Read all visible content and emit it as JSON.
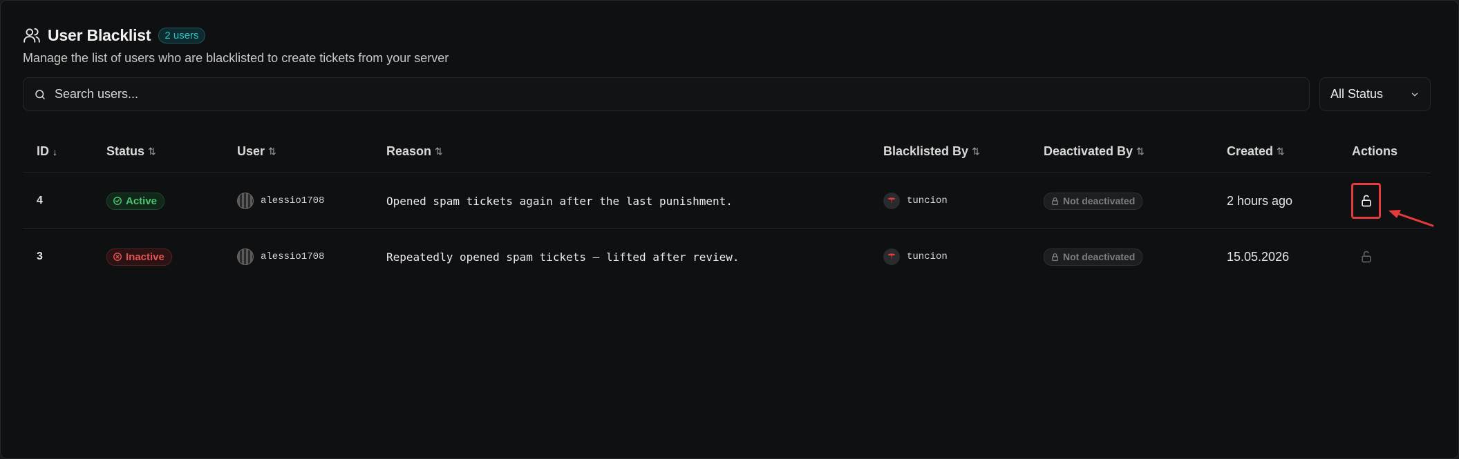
{
  "header": {
    "title": "User Blacklist",
    "count_badge": "2 users",
    "subtitle": "Manage the list of users who are blacklisted to create tickets from your server"
  },
  "search": {
    "placeholder": "Search users..."
  },
  "status_filter": {
    "selected": "All Status"
  },
  "table": {
    "columns": [
      {
        "label": "ID",
        "sort": "↓"
      },
      {
        "label": "Status",
        "sort": "⇅"
      },
      {
        "label": "User",
        "sort": "⇅"
      },
      {
        "label": "Reason",
        "sort": "⇅"
      },
      {
        "label": "Blacklisted By",
        "sort": "⇅"
      },
      {
        "label": "Deactivated By",
        "sort": "⇅"
      },
      {
        "label": "Created",
        "sort": "⇅"
      },
      {
        "label": "Actions",
        "sort": ""
      }
    ],
    "rows": [
      {
        "id": "4",
        "status": "Active",
        "user": "alessio1708",
        "reason": "Opened spam tickets again after the last punishment.",
        "blacklisted_by": "tuncion",
        "deactivated_by": "Not deactivated",
        "created": "2 hours ago"
      },
      {
        "id": "3",
        "status": "Inactive",
        "user": "alessio1708",
        "reason": "Repeatedly opened spam tickets — lifted after review.",
        "blacklisted_by": "tuncion",
        "deactivated_by": "Not deactivated",
        "created": "15.05.2026"
      }
    ]
  },
  "colors": {
    "active": "#4bc66f",
    "inactive": "#e25555",
    "accent": "#2bc2c2",
    "highlight": "#e53b3b"
  }
}
